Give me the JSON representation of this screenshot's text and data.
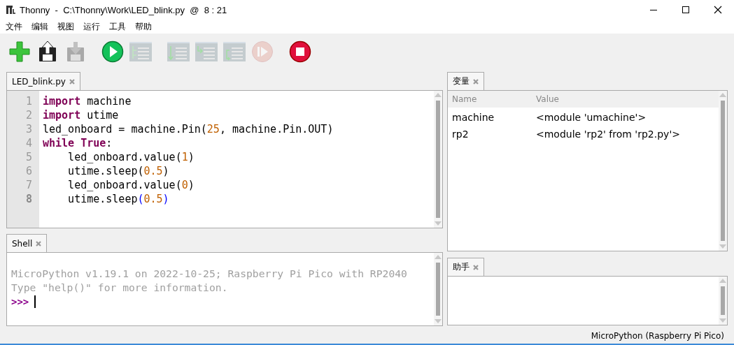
{
  "window": {
    "title": "Thonny  -  C:\\Thonny\\Work\\LED_blink.py  @  8 : 21"
  },
  "menu": [
    "文件",
    "编辑",
    "视图",
    "运行",
    "工具",
    "帮助"
  ],
  "toolbar": [
    {
      "kind": "new",
      "disabled": false
    },
    {
      "kind": "load",
      "disabled": false
    },
    {
      "kind": "save",
      "disabled": true
    },
    {
      "kind": "run",
      "disabled": false
    },
    {
      "kind": "debug",
      "disabled": true
    },
    {
      "kind": "step-over",
      "disabled": true
    },
    {
      "kind": "step-into",
      "disabled": true
    },
    {
      "kind": "step-out",
      "disabled": true
    },
    {
      "kind": "resume",
      "disabled": true
    },
    {
      "kind": "stop",
      "disabled": false
    }
  ],
  "editor": {
    "tabs": [
      {
        "label": "LED_blink.py",
        "selected": true
      }
    ],
    "lines": [
      {
        "number": "1",
        "current": false,
        "tokens": [
          {
            "kind": "keyword",
            "text": "import"
          },
          {
            "kind": "plain",
            "text": " machine"
          }
        ]
      },
      {
        "number": "2",
        "current": false,
        "tokens": [
          {
            "kind": "keyword",
            "text": "import"
          },
          {
            "kind": "plain",
            "text": " utime"
          }
        ]
      },
      {
        "number": "3",
        "current": false,
        "tokens": [
          {
            "kind": "plain",
            "text": "led_onboard = machine.Pin("
          },
          {
            "kind": "number",
            "text": "25"
          },
          {
            "kind": "plain",
            "text": ", machine.Pin.OUT)"
          }
        ]
      },
      {
        "number": "4",
        "current": false,
        "tokens": [
          {
            "kind": "keyword",
            "text": "while"
          },
          {
            "kind": "keyword",
            "text": " True"
          },
          {
            "kind": "plain",
            "text": ":"
          }
        ]
      },
      {
        "number": "5",
        "current": false,
        "tokens": [
          {
            "kind": "plain",
            "text": "    led_onboard.value("
          },
          {
            "kind": "number",
            "text": "1"
          },
          {
            "kind": "plain",
            "text": ")"
          }
        ]
      },
      {
        "number": "6",
        "current": false,
        "tokens": [
          {
            "kind": "plain",
            "text": "    utime.sleep("
          },
          {
            "kind": "number",
            "text": "0.5"
          },
          {
            "kind": "plain",
            "text": ")"
          }
        ]
      },
      {
        "number": "7",
        "current": false,
        "tokens": [
          {
            "kind": "plain",
            "text": "    led_onboard.value("
          },
          {
            "kind": "number",
            "text": "0"
          },
          {
            "kind": "plain",
            "text": ")"
          }
        ]
      },
      {
        "number": "8",
        "current": true,
        "tokens": [
          {
            "kind": "plain",
            "text": "    utime.sleep"
          },
          {
            "kind": "bracket",
            "text": "("
          },
          {
            "kind": "number",
            "text": "0.5"
          },
          {
            "kind": "bracket",
            "text": ")"
          }
        ]
      }
    ]
  },
  "shell": {
    "tabs": [
      {
        "label": "Shell",
        "selected": true
      }
    ],
    "lines": [
      {
        "kind": "info",
        "text": "MicroPython v1.19.1 on 2022-10-25; Raspberry Pi Pico with RP2040"
      },
      {
        "kind": "info",
        "text": "Type \"help()\" for more information."
      }
    ],
    "prompt": ">>>"
  },
  "variables": {
    "tabs": [
      {
        "label": "变量",
        "selected": true
      }
    ],
    "columns": [
      "Name",
      "Value"
    ],
    "rows": [
      {
        "name": "machine",
        "value": "<module 'umachine'>"
      },
      {
        "name": "rp2",
        "value": "<module 'rp2' from 'rp2.py'>"
      }
    ]
  },
  "assistant": {
    "tabs": [
      {
        "label": "助手",
        "selected": true
      }
    ]
  },
  "status_bar": {
    "interpreter": "MicroPython (Raspberry Pi Pico)"
  }
}
